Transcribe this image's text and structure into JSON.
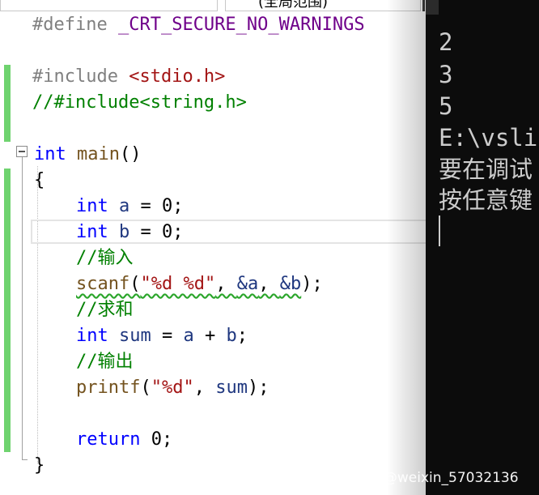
{
  "tab": {
    "right_label": "(全局范围)"
  },
  "code": {
    "l1": {
      "directive": "#define",
      "macro": "_CRT_SECURE_NO_WARNINGS"
    },
    "l3": {
      "directive": "#include",
      "header": "<stdio.h>"
    },
    "l4": {
      "comment": "//#include<string.h>"
    },
    "l6": {
      "type": "int",
      "name": "main",
      "parens": "()"
    },
    "l7": {
      "brace": "{"
    },
    "l8": {
      "type": "int",
      "var": "a",
      "rest": " = 0;"
    },
    "l9": {
      "type": "int",
      "var": "b",
      "rest": " = 0;"
    },
    "l10": {
      "comment": "//输入"
    },
    "l11": {
      "fn": "scanf",
      "open": "(",
      "fmt": "\"%d %d\"",
      "comma": ", ",
      "argA": "&a",
      "comma2": ", ",
      "argB": "&b",
      "close": ");"
    },
    "l12": {
      "comment": "//求和"
    },
    "l13": {
      "type": "int",
      "var": "sum",
      "eq": " = ",
      "a": "a",
      "plus": " + ",
      "b": "b",
      "semi": ";"
    },
    "l14": {
      "comment": "//输出"
    },
    "l15": {
      "fn": "printf",
      "open": "(",
      "fmt": "\"%d\"",
      "comma": ", ",
      "arg": "sum",
      "close": ");"
    },
    "l17": {
      "kw": "return",
      "rest": " 0;"
    },
    "l18": {
      "brace": "}"
    }
  },
  "console": {
    "lines": [
      "2",
      "3",
      "5",
      "E:\\vsli",
      "要在调试",
      "按任意键"
    ]
  },
  "watermark": "CSDN @weixin_57032136",
  "colors": {
    "keyword": "#0000ff",
    "string": "#a31515",
    "comment": "#008000",
    "macro": "#6f008a",
    "preprocessor": "#808080",
    "change_bar": "#6fd36f",
    "console_bg": "#0c0c0c",
    "console_text": "#cccccc"
  }
}
